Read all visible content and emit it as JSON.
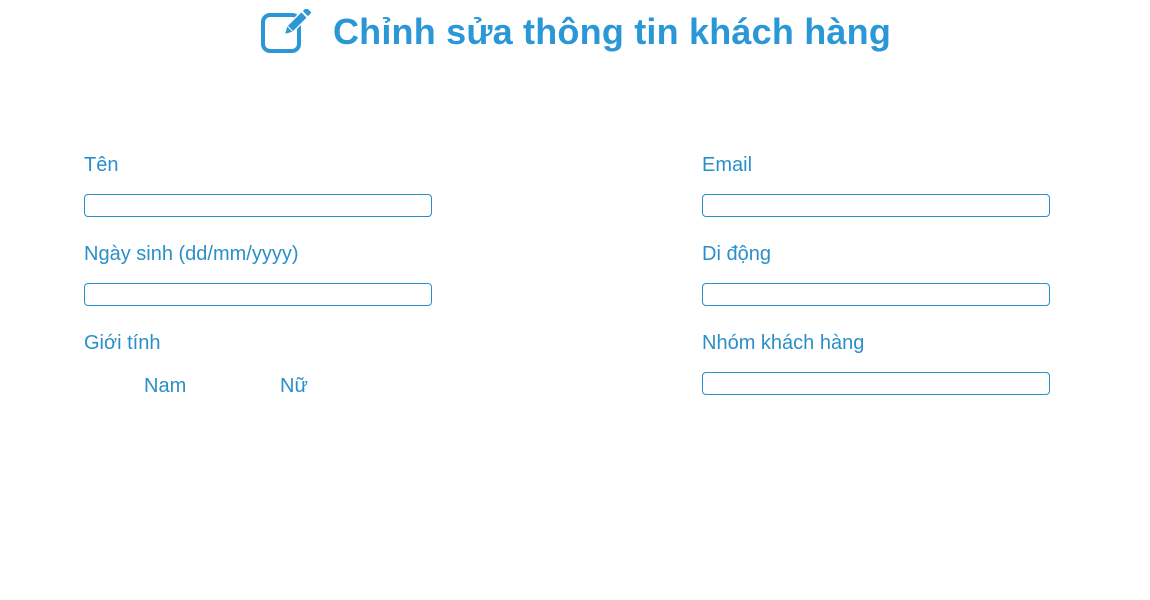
{
  "header": {
    "title": "Chỉnh sửa thông tin khách hàng",
    "icon": "edit-icon"
  },
  "form": {
    "name": {
      "label": "Tên",
      "value": "",
      "placeholder": ""
    },
    "birthday": {
      "label": "Ngày sinh (dd/mm/yyyy)",
      "value": "",
      "placeholder": ""
    },
    "gender": {
      "label": "Giới tính",
      "options": [
        "Nam",
        "Nữ"
      ]
    },
    "email": {
      "label": "Email",
      "value": "",
      "placeholder": ""
    },
    "mobile": {
      "label": "Di động",
      "value": "",
      "placeholder": ""
    },
    "customer_group": {
      "label": "Nhóm khách hàng",
      "value": "",
      "placeholder": ""
    }
  },
  "colors": {
    "accent": "#2a97d6",
    "label": "#2a8fc9",
    "border": "#2a8fc9"
  }
}
